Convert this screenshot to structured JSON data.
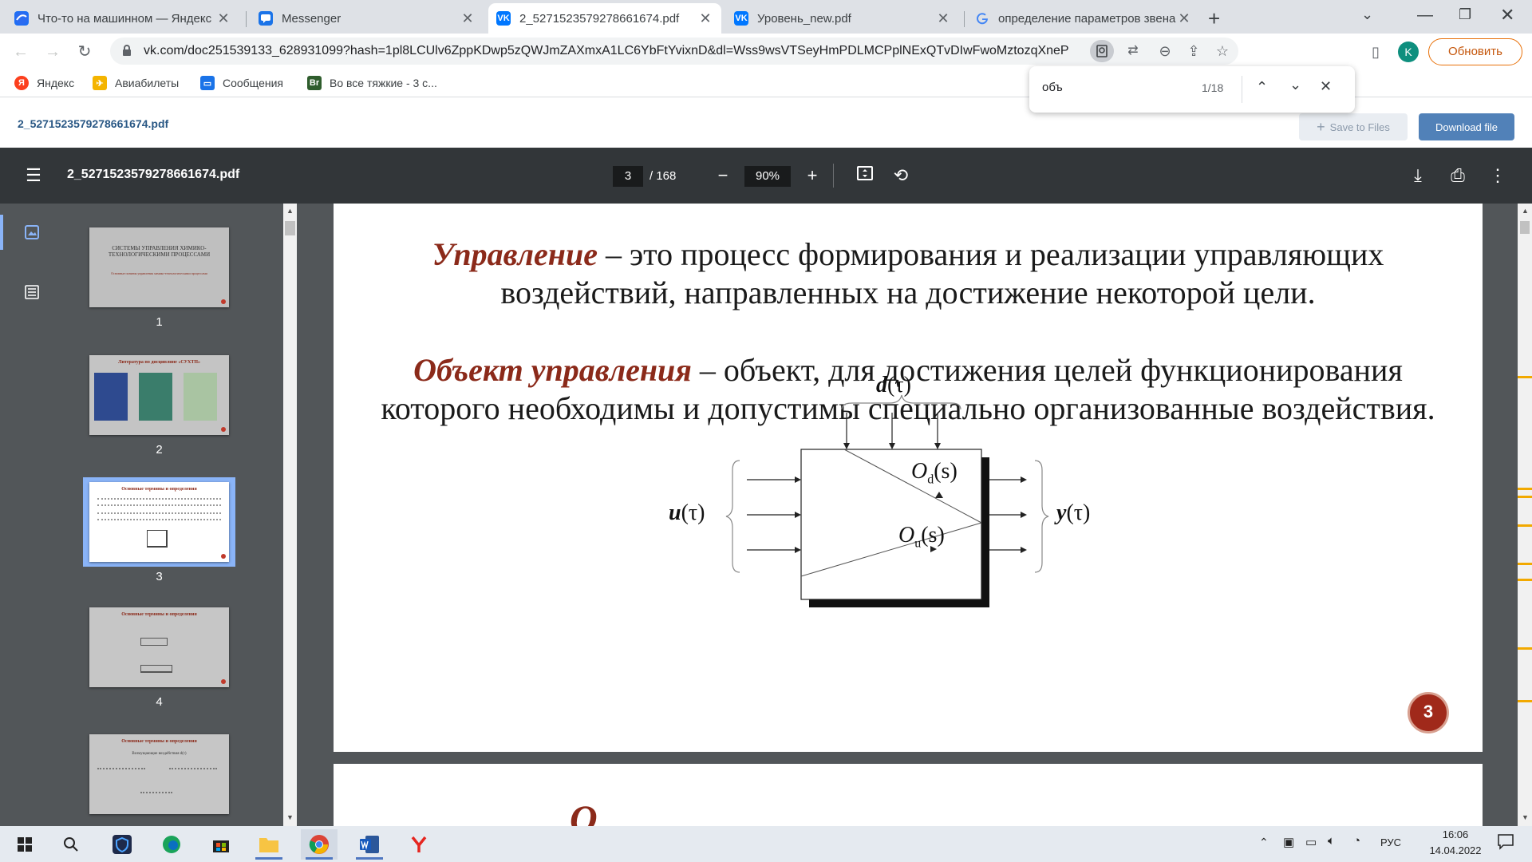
{
  "tabs": [
    {
      "title": "Что-то на машинном — Яндекс",
      "icon": "yandex-icon",
      "active": false
    },
    {
      "title": "Messenger",
      "icon": "messenger-icon",
      "active": false
    },
    {
      "title": "2_5271523579278661674.pdf",
      "icon": "vk-icon",
      "active": true
    },
    {
      "title": "Уровень_new.pdf",
      "icon": "vk-icon",
      "active": false
    },
    {
      "title": "определение параметров звена",
      "icon": "google-icon",
      "active": false
    }
  ],
  "address": {
    "url": "vk.com/doc251539133_628931099?hash=1pl8LCUlv6ZppKDwp5zQWJmZAXmxA1LC6YbFtYvixnD&dl=Wss9wsVTSeyHmPDLMCPplNExQTvDIwFwoMztozqXneP"
  },
  "profile": {
    "initial": "K",
    "update_label": "Обновить"
  },
  "bookmarks": [
    {
      "label": "Яндекс",
      "icon": "yandex-icon"
    },
    {
      "label": "Авиабилеты",
      "icon": "tickets-icon"
    },
    {
      "label": "Сообщения",
      "icon": "messages-icon"
    },
    {
      "label": "Во все тяжкие - 3 с...",
      "icon": "br-icon"
    }
  ],
  "find": {
    "query": "объ",
    "count": "1/18"
  },
  "vk": {
    "file_name": "2_5271523579278661674.pdf",
    "save_label": "Save to Files",
    "download_label": "Download file"
  },
  "pdf": {
    "file_name": "2_5271523579278661674.pdf",
    "current_page": "3",
    "total_pages": "/ 168",
    "zoom": "90%"
  },
  "thumbnails": [
    {
      "number": "1",
      "title": "СИСТЕМЫ УПРАВЛЕНИЯ ХИМИКО-ТЕХНОЛОГИЧЕСКИМИ ПРОЦЕССАМИ",
      "subtitle": "Основные понятия управления химико-технологическими процессами"
    },
    {
      "number": "2",
      "title": "Литература по дисциплине «СУХТП»",
      "subtitle": ""
    },
    {
      "number": "3",
      "title": "Основные термины и определения",
      "subtitle": ""
    },
    {
      "number": "4",
      "title": "Основные термины и определения",
      "subtitle": ""
    },
    {
      "number": "5",
      "title": "Основные термины и определения",
      "subtitle": "Возмущающие воздействия d(τ)"
    }
  ],
  "slide": {
    "term1": "Управление",
    "def1_line1": " – это процесс формирования и реализации управляющих",
    "def1_line2": "воздействий, направленных на достижение некоторой цели.",
    "term2": "Объект управления",
    "def2_line1": " – объект, для достижения целей функционирования",
    "def2_line2": "которого необходимы и допустимы специально организованные воздействия.",
    "page_badge": "3",
    "diagram": {
      "disturbance_label": "d",
      "input_label": "u",
      "output_label": "y",
      "arg": "(τ)",
      "od_label": "O",
      "od_sub": "d",
      "ou_label": "O",
      "ou_sub": "u",
      "s_arg": "(s)"
    }
  },
  "next_page_fragment": "О",
  "taskbar": {
    "lang": "РУС",
    "time": "16:06",
    "date": "14.04.2022"
  },
  "colors": {
    "term": "#8b2a1a",
    "pdf_toolbar": "#323639",
    "sidebar": "#525659",
    "vk_button": "#5181b8",
    "badge": "#a0291a"
  }
}
